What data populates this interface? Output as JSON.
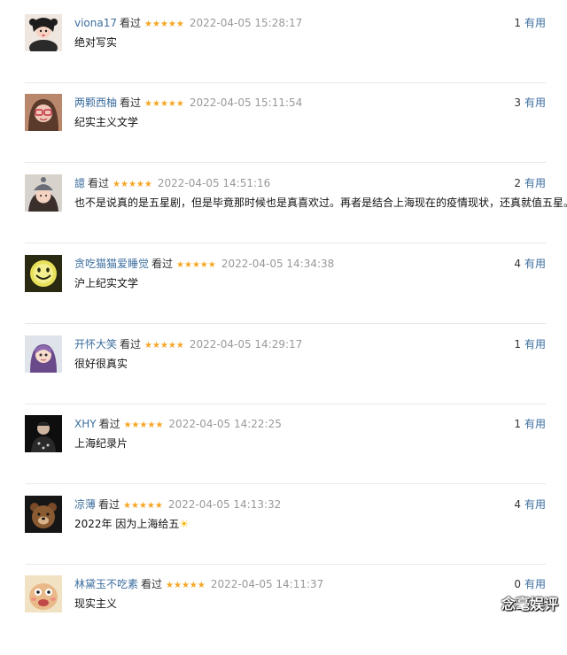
{
  "reviews": [
    {
      "user": "viona17",
      "status": "看过",
      "stars": "★★★★★",
      "time": "2022-04-05 15:28:17",
      "content": "绝对写实",
      "votes": "1",
      "vote_label": "有用",
      "avatar_icon": "avatar-doll-girl"
    },
    {
      "user": "两颗西柚",
      "status": "看过",
      "stars": "★★★★★",
      "time": "2022-04-05 15:11:54",
      "content": "纪实主义文学",
      "votes": "3",
      "vote_label": "有用",
      "avatar_icon": "avatar-girl-glasses"
    },
    {
      "user": "譩",
      "status": "看过",
      "stars": "★★★★★",
      "time": "2022-04-05 14:51:16",
      "content": "也不是说真的是五星剧，但是毕竟那时候也是真喜欢过。再者是结合上海现在的疫情现状，还真就值五星。",
      "votes": "2",
      "vote_label": "有用",
      "avatar_icon": "avatar-girl-beanie"
    },
    {
      "user": "贪吃猫猫爱睡觉",
      "status": "看过",
      "stars": "★★★★★",
      "time": "2022-04-05 14:34:38",
      "content": "沪上纪实文学",
      "votes": "4",
      "vote_label": "有用",
      "avatar_icon": "avatar-smiley-neon"
    },
    {
      "user": "开怀大笑",
      "status": "看过",
      "stars": "★★★★★",
      "time": "2022-04-05 14:29:17",
      "content": "很好很真实",
      "votes": "1",
      "vote_label": "有用",
      "avatar_icon": "avatar-doll-purple"
    },
    {
      "user": "XHY",
      "status": "看过",
      "stars": "★★★★★",
      "time": "2022-04-05 14:22:25",
      "content": "上海纪录片",
      "votes": "1",
      "vote_label": "有用",
      "avatar_icon": "avatar-man-dark"
    },
    {
      "user": "凉薄",
      "status": "看过",
      "stars": "★★★★★",
      "time": "2022-04-05 14:13:32",
      "content": "2022年 因为上海给五",
      "content_emoji": "☀",
      "votes": "4",
      "vote_label": "有用",
      "avatar_icon": "avatar-bear"
    },
    {
      "user": "林黛玉不吃素",
      "status": "看过",
      "stars": "★★★★★",
      "time": "2022-04-05 14:11:37",
      "content": "现实主义",
      "votes": "0",
      "vote_label": "有用",
      "avatar_icon": "avatar-cartoon-face"
    }
  ],
  "watermark": "念毫娱评",
  "colors": {
    "link": "#3c6e9f",
    "star": "#f5a623",
    "time": "#999999",
    "separator": "#e8e8e8"
  }
}
